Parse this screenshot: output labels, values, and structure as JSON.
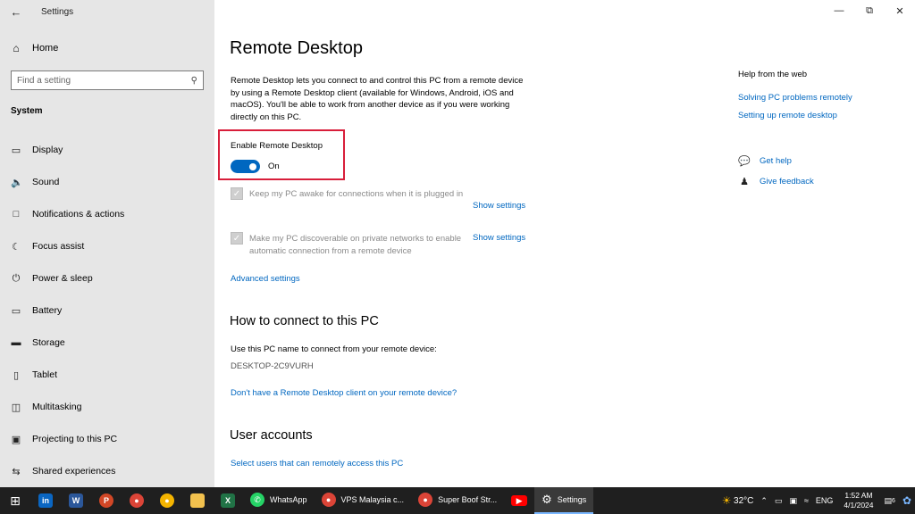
{
  "window": {
    "title": "Settings"
  },
  "sidebar": {
    "home_label": "Home",
    "search_placeholder": "Find a setting",
    "section_label": "System",
    "items": [
      {
        "label": "Display",
        "icon": "monitor-icon"
      },
      {
        "label": "Sound",
        "icon": "speaker-icon"
      },
      {
        "label": "Notifications & actions",
        "icon": "notification-icon"
      },
      {
        "label": "Focus assist",
        "icon": "moon-icon"
      },
      {
        "label": "Power & sleep",
        "icon": "power-icon"
      },
      {
        "label": "Battery",
        "icon": "battery-icon"
      },
      {
        "label": "Storage",
        "icon": "storage-icon"
      },
      {
        "label": "Tablet",
        "icon": "tablet-icon"
      },
      {
        "label": "Multitasking",
        "icon": "multitasking-icon"
      },
      {
        "label": "Projecting to this PC",
        "icon": "projecting-icon"
      },
      {
        "label": "Shared experiences",
        "icon": "shared-experiences-icon"
      }
    ]
  },
  "main": {
    "title": "Remote Desktop",
    "description": "Remote Desktop lets you connect to and control this PC from a remote device by using a Remote Desktop client (available for Windows, Android, iOS and macOS). You'll be able to work from another device as if you were working directly on this PC.",
    "enable_label": "Enable Remote Desktop",
    "toggle_state": "On",
    "options": [
      {
        "text": "Keep my PC awake for connections when it is plugged in",
        "link": "Show settings",
        "checked": true
      },
      {
        "text": "Make my PC discoverable on private networks to enable automatic connection from a remote device",
        "link": "Show settings",
        "checked": true
      }
    ],
    "advanced_link": "Advanced settings",
    "connect_heading": "How to connect to this PC",
    "connect_text": "Use this PC name to connect from your remote device:",
    "pc_name": "DESKTOP-2C9VURH",
    "client_link": "Don't have a Remote Desktop client on your remote device?",
    "accounts_heading": "User accounts",
    "accounts_link": "Select users that can remotely access this PC"
  },
  "help": {
    "title": "Help from the web",
    "links": [
      "Solving PC problems remotely",
      "Setting up remote desktop"
    ],
    "get_help": "Get help",
    "feedback": "Give feedback"
  },
  "taskbar": {
    "apps": [
      {
        "label": "WhatsApp",
        "color": "#25d366"
      },
      {
        "label": "VPS Malaysia c...",
        "color": "#db4437"
      },
      {
        "label": "Super Boof Str...",
        "color": "#db4437"
      },
      {
        "label": "Settings",
        "color": "#3a3a3a"
      }
    ],
    "temperature": "32°C",
    "language": "ENG",
    "time": "1:52 AM",
    "date": "4/1/2024",
    "notif_count": "6"
  },
  "colors": {
    "accent": "#0067c0",
    "highlight": "#d81e3a"
  }
}
